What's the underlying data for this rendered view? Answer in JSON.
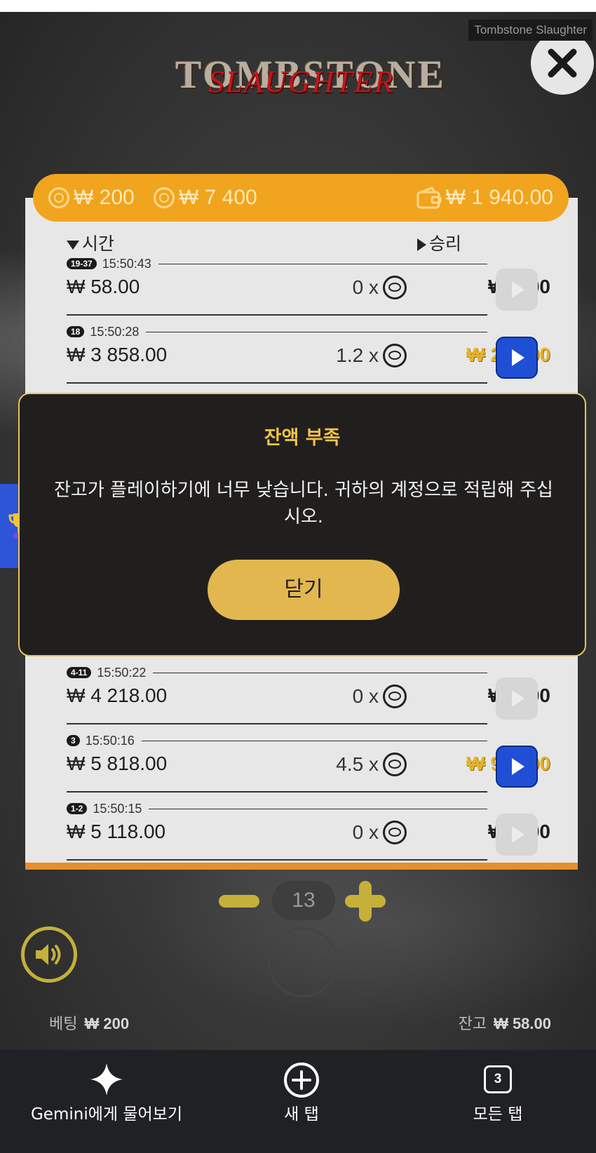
{
  "game": {
    "window_title": "Tombstone Slaughter",
    "logo_top": "TOMBSTONE",
    "logo_bottom": "SLAUGHTER"
  },
  "stats": {
    "bet": "₩ 200",
    "win": "₩ 7 400",
    "balance": "₩ 1 940.00"
  },
  "history": {
    "col_time": "시간",
    "col_win": "승리",
    "rows": [
      {
        "badge": "19-37",
        "time": "15:50:43",
        "amount": "₩ 58.00",
        "multiplier": "0 x",
        "win": "₩ 0.00",
        "highlight": false
      },
      {
        "badge": "18",
        "time": "15:50:28",
        "amount": "₩ 3 858.00",
        "multiplier": "1.2 x",
        "win": "₩ 240.00",
        "highlight": true
      },
      {
        "badge": "4-11",
        "time": "15:50:22",
        "amount": "₩ 4 218.00",
        "multiplier": "0 x",
        "win": "₩ 0.00",
        "highlight": false
      },
      {
        "badge": "3",
        "time": "15:50:16",
        "amount": "₩ 5 818.00",
        "multiplier": "4.5 x",
        "win": "₩ 900.00",
        "highlight": true
      },
      {
        "badge": "1-2",
        "time": "15:50:15",
        "amount": "₩ 5 118.00",
        "multiplier": "0 x",
        "win": "₩ 0.00",
        "highlight": false
      }
    ]
  },
  "dialog": {
    "title": "잔액 부족",
    "message": "잔고가 플레이하기에 너무 낮습니다. 귀하의 계정으로 적립해 주십시오.",
    "button": "닫기"
  },
  "stepper": {
    "value": "13"
  },
  "footer": {
    "bet_label": "베팅",
    "bet_value": "₩ 200",
    "balance_label": "잔고",
    "balance_value": "₩ 58.00"
  },
  "nav": {
    "gemini": "Gemini에게 물어보기",
    "new_tab": "새 탭",
    "all_tabs": "모든 탭",
    "tab_count": "3"
  },
  "colors": {
    "accent_orange": "#f1a41e",
    "gold": "#e2b74f",
    "play_blue": "#1f4fd4"
  }
}
